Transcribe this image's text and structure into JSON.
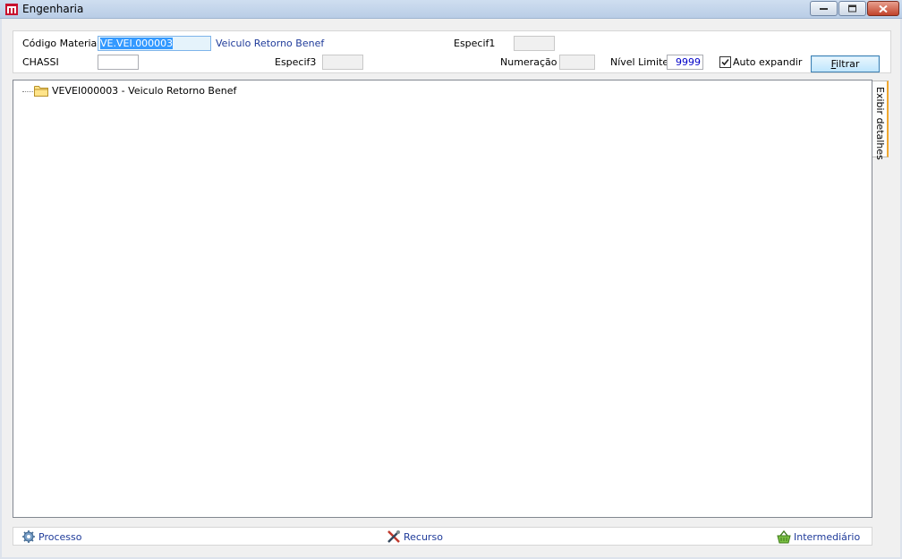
{
  "window": {
    "title": "Engenharia"
  },
  "filters": {
    "codigo_material_label": "Código Material",
    "codigo_material_value": "VE.VEI.000003",
    "codigo_material_desc": "Veiculo Retorno Benef",
    "especif1_label": "Especif1",
    "especif1_value": "",
    "chassi_label": "CHASSI",
    "chassi_value": "",
    "especif3_label": "Especif3",
    "especif3_value": "",
    "numeracao_label": "Numeração",
    "numeracao_value": "",
    "nivel_limite_label": "Nível Limite",
    "nivel_limite_value": "9999",
    "auto_expandir_label": "Auto expandir",
    "auto_expandir_checked": true,
    "filtrar_prefix": "F",
    "filtrar_rest": "iltrar"
  },
  "tree": {
    "root_label": "VEVEI000003 - Veiculo Retorno Benef"
  },
  "side_tab": {
    "label": "Exibir detalhes",
    "accent": "#f0a830"
  },
  "bottom": {
    "processo": "Processo",
    "recurso": "Recurso",
    "intermediario": "Intermediário"
  }
}
